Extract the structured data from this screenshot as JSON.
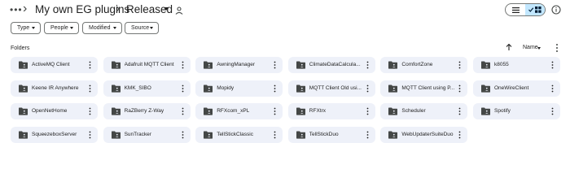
{
  "breadcrumb": {
    "overflow": "•••",
    "parent": "My own EG plugins",
    "current": "Released"
  },
  "filters": {
    "type": "Type",
    "people": "People",
    "modified": "Modified",
    "source": "Source"
  },
  "section": {
    "label": "Folders"
  },
  "sort": {
    "label": "Name"
  },
  "folders": [
    "ActiveMQ Client",
    "Adafruit MQTT Client",
    "AwningManager",
    "ClimateDataCalcula...",
    "ComfortZone",
    "k8055",
    "Keene IR Anywhere",
    "KMK_SIBO",
    "Mopidy",
    "MQTT Client Old usi...",
    "MQTT Client using P...",
    "OneWireClient",
    "OpenNetHome",
    "RaZBerry Z-Way",
    "RFXcom_xPL",
    "RFXtrx",
    "Scheduler",
    "Spotify",
    "SqueezeboxServer",
    "SunTracker",
    "TellStickClassic",
    "TellStickDuo",
    "WebUpdaterSuiteDuo"
  ],
  "colors": {
    "accent": "#c2e7ff",
    "tile": "#eef1f9",
    "text": "#1f1f1f"
  }
}
